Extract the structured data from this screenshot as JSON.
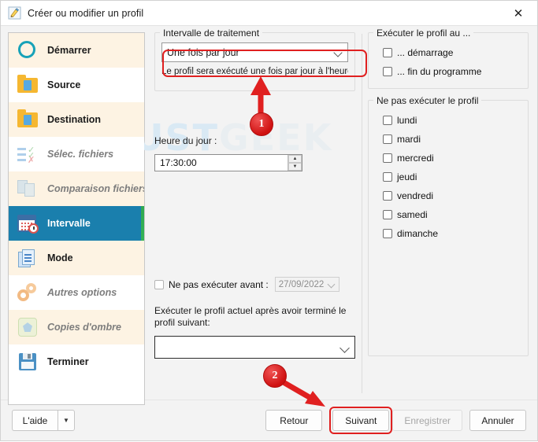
{
  "window": {
    "title": "Créer ou modifier un profil",
    "title_icon": "edit-profile-icon",
    "close_icon": "✕"
  },
  "sidebar": {
    "items": [
      {
        "label": "Démarrer",
        "icon": "circle-icon",
        "state": "normal",
        "bg": "alt"
      },
      {
        "label": "Source",
        "icon": "folder-icon",
        "state": "normal",
        "bg": "white"
      },
      {
        "label": "Destination",
        "icon": "folder-icon",
        "state": "normal",
        "bg": "alt"
      },
      {
        "label": "Sélec. fichiers",
        "icon": "file-select-icon",
        "state": "disabled",
        "bg": "white"
      },
      {
        "label": "Comparaison fichiers",
        "icon": "compare-files-icon",
        "state": "disabled",
        "bg": "alt"
      },
      {
        "label": "Intervalle",
        "icon": "calendar-clock-icon",
        "state": "selected",
        "bg": "selected"
      },
      {
        "label": "Mode",
        "icon": "documents-icon",
        "state": "normal",
        "bg": "alt"
      },
      {
        "label": "Autres options",
        "icon": "gears-icon",
        "state": "disabled",
        "bg": "white"
      },
      {
        "label": "Copies d'ombre",
        "icon": "shadow-copy-icon",
        "state": "disabled",
        "bg": "alt"
      },
      {
        "label": "Terminer",
        "icon": "save-disk-icon",
        "state": "normal",
        "bg": "white"
      }
    ]
  },
  "center": {
    "interval_group_legend": "Intervalle de traitement",
    "interval_select_value": "Une fois par jour",
    "interval_help_text": "Le profil sera exécuté une fois par jour à l'heure spé",
    "time_label": "Heure du jour :",
    "time_value": "17:30:00",
    "not_before_label": "Ne pas exécuter avant :",
    "not_before_checked": false,
    "not_before_date": "27/09/2022",
    "chain_label": "Exécuter le profil actuel après avoir terminé le profil suivant:",
    "chain_select_value": ""
  },
  "right": {
    "run_group_legend": "Exécuter le profil au ...",
    "run_options": [
      {
        "label": "... démarrage",
        "checked": false
      },
      {
        "label": "... fin du programme",
        "checked": false
      }
    ],
    "skip_group_legend": "Ne pas exécuter le profil",
    "days": [
      {
        "label": "lundi",
        "checked": false
      },
      {
        "label": "mardi",
        "checked": false
      },
      {
        "label": "mercredi",
        "checked": false
      },
      {
        "label": "jeudi",
        "checked": false
      },
      {
        "label": "vendredi",
        "checked": false
      },
      {
        "label": "samedi",
        "checked": false
      },
      {
        "label": "dimanche",
        "checked": false
      }
    ]
  },
  "footer": {
    "help_label": "L'aide",
    "help_arrow": "▼",
    "back_label": "Retour",
    "next_label": "Suivant",
    "save_label": "Enregistrer",
    "cancel_label": "Annuler",
    "save_disabled": true,
    "next_highlighted": true
  },
  "annotations": {
    "step1": "1",
    "step2": "2",
    "accent_color": "#e02020"
  },
  "watermark": {
    "text_a": "JUST",
    "text_b": "GEEK"
  }
}
